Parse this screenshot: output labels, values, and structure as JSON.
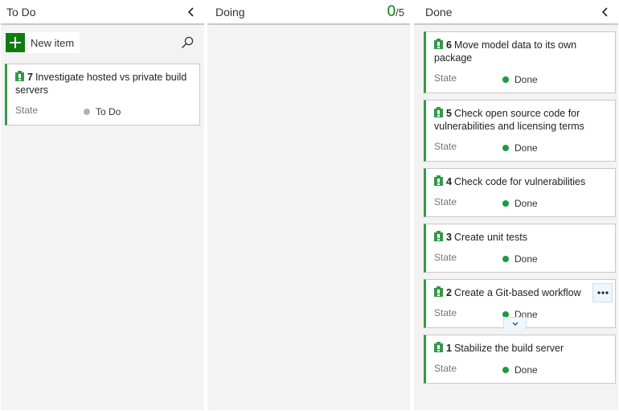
{
  "board": {
    "colors": {
      "accent_green": "#107c10",
      "card_stripe": "#339947",
      "done_dot": "#1a9c3e",
      "todo_dot": "#b2b2b2"
    },
    "columns": [
      {
        "id": "todo",
        "title": "To Do",
        "collapse_icon": "chevron-left-icon",
        "toolbar": {
          "new_item_label": "New item",
          "new_item_icon": "plus-icon",
          "search_icon": "search-icon"
        },
        "cards": [
          {
            "id": "7",
            "title": "Investigate hosted vs private build servers",
            "type_icon": "product-backlog-item-icon",
            "field_label": "State",
            "state": "To Do",
            "state_color": "#b2b2b2"
          }
        ]
      },
      {
        "id": "doing",
        "title": "Doing",
        "wip": {
          "current": "0",
          "limit": "/5"
        },
        "cards": []
      },
      {
        "id": "done",
        "title": "Done",
        "collapse_icon": "chevron-left-icon",
        "cards": [
          {
            "id": "6",
            "title": "Move model data to its own package",
            "type_icon": "product-backlog-item-icon",
            "field_label": "State",
            "state": "Done",
            "state_color": "#1a9c3e"
          },
          {
            "id": "5",
            "title": "Check open source code for vulnerabilities and licensing terms",
            "type_icon": "product-backlog-item-icon",
            "field_label": "State",
            "state": "Done",
            "state_color": "#1a9c3e"
          },
          {
            "id": "4",
            "title": "Check code for vulnerabilities",
            "type_icon": "product-backlog-item-icon",
            "field_label": "State",
            "state": "Done",
            "state_color": "#1a9c3e"
          },
          {
            "id": "3",
            "title": "Create unit tests",
            "type_icon": "product-backlog-item-icon",
            "field_label": "State",
            "state": "Done",
            "state_color": "#1a9c3e"
          },
          {
            "id": "2",
            "title": "Create a Git-based workflow",
            "type_icon": "product-backlog-item-icon",
            "field_label": "State",
            "state": "Done",
            "state_color": "#1a9c3e",
            "hovered": true,
            "more_icon": "more-options-icon",
            "expand_icon": "chevron-down-icon"
          },
          {
            "id": "1",
            "title": "Stabilize the build server",
            "type_icon": "product-backlog-item-icon",
            "field_label": "State",
            "state": "Done",
            "state_color": "#1a9c3e"
          }
        ]
      }
    ]
  }
}
